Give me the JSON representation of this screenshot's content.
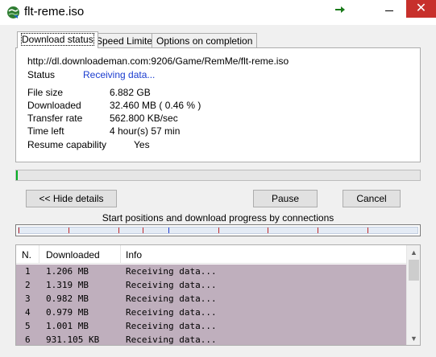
{
  "window": {
    "title": "flt-reme.iso"
  },
  "tabs": [
    {
      "label": "Download status"
    },
    {
      "label": "Speed Limiter"
    },
    {
      "label": "Options on completion"
    }
  ],
  "status": {
    "url": "http://dl.downloademan.com:9206/Game/RemMe/flt-reme.iso",
    "status_label": "Status",
    "status_value": "Receiving data...",
    "file_size_label": "File size",
    "file_size_value": "6.882  GB",
    "downloaded_label": "Downloaded",
    "downloaded_value": "32.460  MB  ( 0.46 % )",
    "transfer_rate_label": "Transfer rate",
    "transfer_rate_value": "562.800  KB/sec",
    "time_left_label": "Time left",
    "time_left_value": "4 hour(s) 57 min",
    "resume_label": "Resume capability",
    "resume_value": "Yes",
    "status_color": "#1a3ccf"
  },
  "progress": {
    "fraction": 0.0046,
    "color": "#06b025"
  },
  "buttons": {
    "hide_details": "<< Hide details",
    "pause": "Pause",
    "cancel": "Cancel"
  },
  "connections": {
    "title": "Start positions and download progress by connections",
    "positions": [
      0.0,
      0.125,
      0.25,
      0.312,
      0.375,
      0.5,
      0.625,
      0.75,
      0.875
    ],
    "active_position": 0.375
  },
  "table": {
    "headers": [
      "N.",
      "Downloaded",
      "Info"
    ],
    "rows": [
      {
        "n": "1",
        "downloaded": "1.206  MB",
        "info": "Receiving data..."
      },
      {
        "n": "2",
        "downloaded": "1.319  MB",
        "info": "Receiving data..."
      },
      {
        "n": "3",
        "downloaded": "0.982  MB",
        "info": "Receiving data..."
      },
      {
        "n": "4",
        "downloaded": "0.979  MB",
        "info": "Receiving data..."
      },
      {
        "n": "5",
        "downloaded": "1.001  MB",
        "info": "Receiving data..."
      },
      {
        "n": "6",
        "downloaded": "931.105  KB",
        "info": "Receiving data..."
      }
    ],
    "row_bg": "#bfafbd"
  },
  "icons": {
    "app": "app-globe-icon",
    "title_action": "arrow-right-icon",
    "minimize": "minimize-icon",
    "close": "close-icon"
  }
}
